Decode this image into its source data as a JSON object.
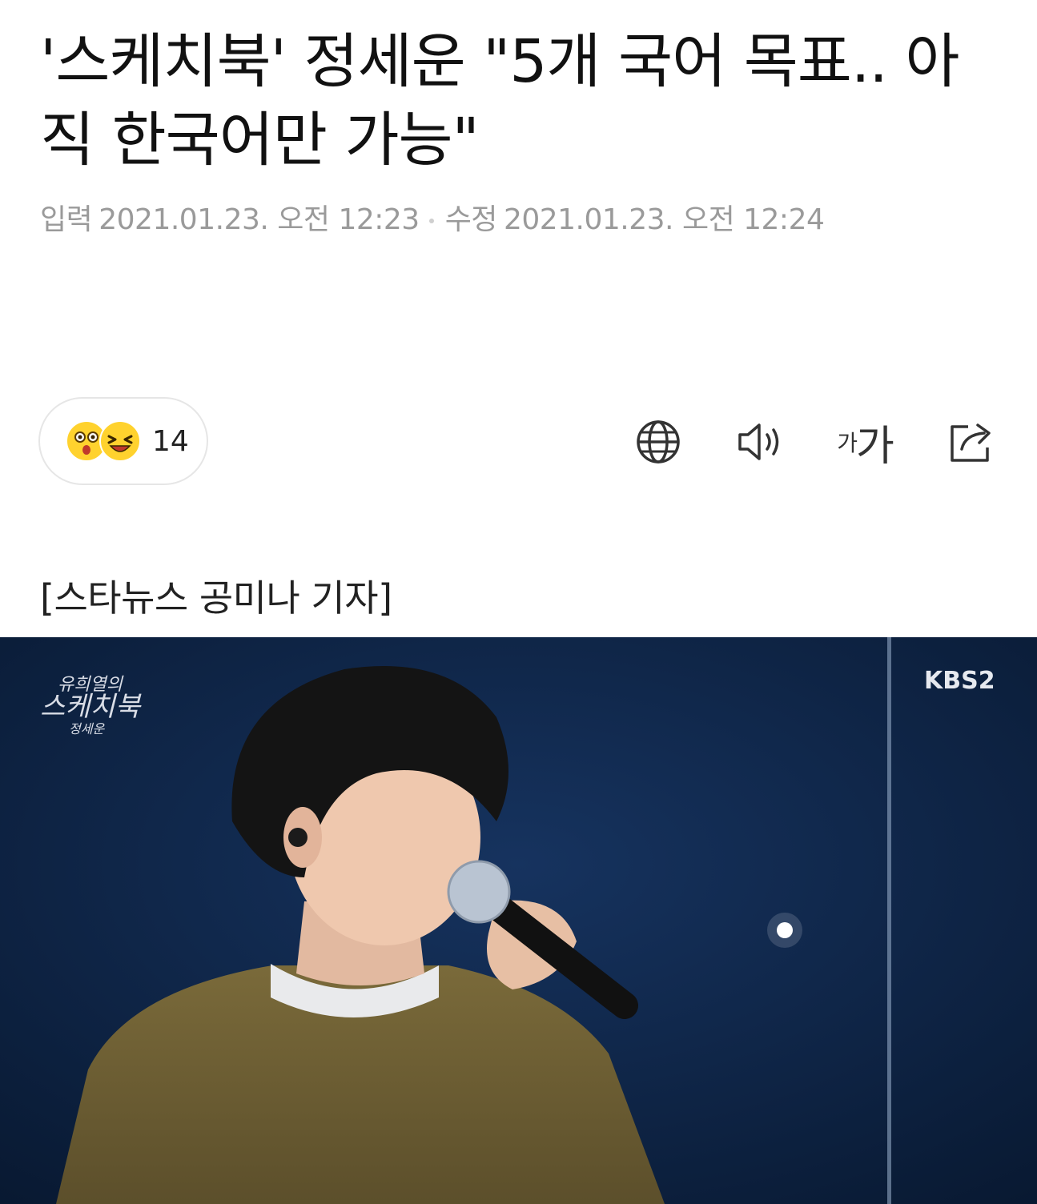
{
  "article": {
    "headline": "'스케치북' 정세운 \"5개 국어 목표.. 아직 한국어만 가능\"",
    "published_label": "입력",
    "published_time": "2021.01.23. 오전 12:23",
    "modified_label": "수정",
    "modified_time": "2021.01.23. 오전 12:24",
    "byline": "[스타뉴스 공미나 기자]"
  },
  "reactions": {
    "count": "14",
    "emojis": [
      "surprised-face-icon",
      "laughing-face-icon"
    ],
    "emoji_color": "#ffd22e"
  },
  "toolbar": {
    "translate_icon": "globe-icon",
    "tts_icon": "speaker-icon",
    "font_size_small": "가",
    "font_size_large": "가",
    "share_icon": "share-icon"
  },
  "photo": {
    "broadcaster_logo": "KBS2",
    "program_logo_line1": "유희열의",
    "program_logo_line2": "스케치북",
    "program_logo_line3": "정세운"
  },
  "colors": {
    "meta_text": "#9a9a9a",
    "stage_background": "#0c1f3d"
  }
}
